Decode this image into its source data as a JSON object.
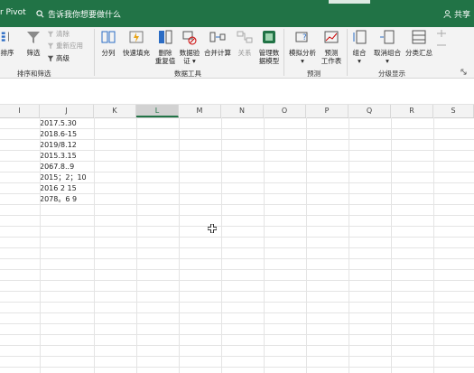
{
  "title_bar": {
    "tab_label": "r Pivot",
    "tell_me": "告诉我你想要做什么",
    "share": "共享"
  },
  "ribbon": {
    "sort": "排序",
    "filter": "筛选",
    "clear": "清除",
    "reapply": "重新应用",
    "advanced": "高级",
    "text_to_columns": "分列",
    "flash_fill": "快速填充",
    "remove_duplicates": [
      "删除",
      "重复值"
    ],
    "data_validation": [
      "数据验",
      "证 ▾"
    ],
    "consolidate": "合并计算",
    "relationships": "关系",
    "manage_model": [
      "管理数",
      "据模型"
    ],
    "what_if": [
      "模拟分析",
      "▾"
    ],
    "forecast_sheet": [
      "预测",
      "工作表"
    ],
    "group": [
      "组合",
      "▾"
    ],
    "ungroup": [
      "取消组合",
      "▾"
    ],
    "subtotal": "分类汇总",
    "groups": {
      "sort_filter": "排序和筛选",
      "data_tools": "数据工具",
      "forecast": "预测",
      "outline": "分级显示"
    }
  },
  "columns": [
    "I",
    "J",
    "K",
    "L",
    "M",
    "N",
    "O",
    "P",
    "Q",
    "R",
    "S"
  ],
  "selected_column": "L",
  "cells": [
    "2017.5.30",
    "2018.6-15",
    "2019/8.12",
    "2015.3.15",
    "2067.8..9",
    "2015；2；10",
    "2016 2 15",
    "2078。6 9"
  ]
}
